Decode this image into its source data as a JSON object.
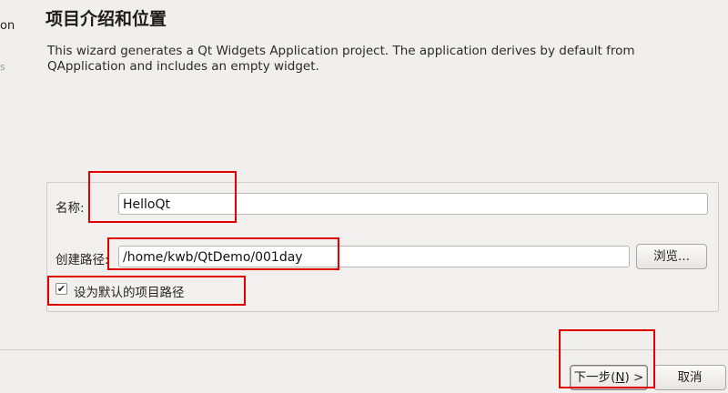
{
  "sidebar": {
    "fragment_1": "on",
    "fragment_2": "s"
  },
  "header": {
    "title": "项目介绍和位置"
  },
  "description": "This wizard generates a Qt Widgets Application project. The application derives by default from QApplication and includes an empty widget.",
  "form": {
    "name_label": "名称:",
    "name_value": "HelloQt",
    "path_label": "创建路径:",
    "path_value": "/home/kwb/QtDemo/001day",
    "browse_label": "浏览...",
    "default_checkbox_label": "设为默认的项目路径",
    "default_checked": true,
    "check_mark": "✔"
  },
  "footer": {
    "next_label_pre": "下一步(",
    "next_label_mnemonic": "N",
    "next_label_post": ") >",
    "cancel_label": "取消"
  },
  "colors": {
    "annotation": "#e00000",
    "background": "#f1efed"
  }
}
